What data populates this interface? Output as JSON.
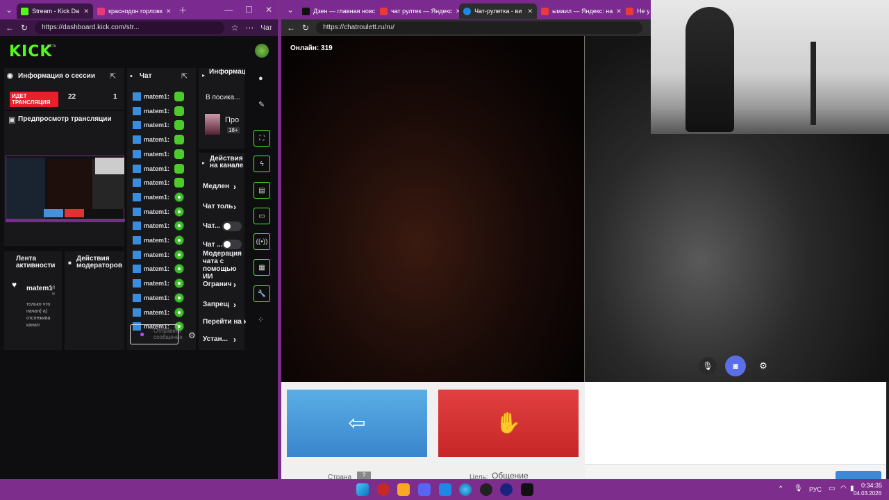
{
  "left_browser": {
    "tabs": [
      {
        "label": "Stream - Kick Da",
        "color": "#53fc18",
        "active": true
      },
      {
        "label": "краснодон горловк",
        "color": "#e83a7a",
        "active": false
      }
    ],
    "url": "https://dashboard.kick.com/str...",
    "copilot_label": "Чат"
  },
  "kick": {
    "logo": "KICK",
    "beta": "BETA",
    "session_panel": {
      "title": "Информация о сессии",
      "status": "ИДЕТ ТРАНСЛЯЦИЯ",
      "viewers": "22",
      "followers": "1"
    },
    "preview_title": "Предпросмотр трансляции",
    "chat": {
      "title": "Чат",
      "rows": [
        {
          "user": "matem1:",
          "emote": "green"
        },
        {
          "user": "matem1:",
          "emote": "green"
        },
        {
          "user": "matem1:",
          "emote": "green"
        },
        {
          "user": "matem1:",
          "emote": "green"
        },
        {
          "user": "matem1:",
          "emote": "green"
        },
        {
          "user": "matem1:",
          "emote": "green"
        },
        {
          "user": "matem1:",
          "emote": "green"
        },
        {
          "user": "matem1:",
          "emote": "round"
        },
        {
          "user": "matem1:",
          "emote": "round"
        },
        {
          "user": "matem1:",
          "emote": "round"
        },
        {
          "user": "matem1:",
          "emote": "round"
        },
        {
          "user": "matem1:",
          "emote": "round"
        },
        {
          "user": "matem1:",
          "emote": "round"
        },
        {
          "user": "matem1:",
          "emote": "round"
        },
        {
          "user": "matem1:",
          "emote": "round"
        },
        {
          "user": "matem1:",
          "emote": "round"
        },
        {
          "user": "matem1:",
          "emote": "round"
        }
      ],
      "input_placeholder": "Отправить сообщение"
    },
    "stream_info": {
      "title": "Информация о трансляции",
      "category_line": "В посика...",
      "category_name": "Про",
      "age_badge": "18+"
    },
    "channel_actions": {
      "title": "Действия на канале",
      "items": [
        "Медлен",
        "Чат толь",
        "Чат...",
        "Чат ...",
        "Модерация чата с помощью ИИ",
        "Огранич",
        "Запрещ",
        "Перейти на к",
        "Устан..."
      ]
    },
    "activity": {
      "title": "Лента активности",
      "user": "matem1",
      "suffix": "Mi",
      "suffix2": "н",
      "text": "только что начал(-а) отслежива канал"
    },
    "mod_actions": {
      "title": "Действия модераторов"
    }
  },
  "right_browser": {
    "tabs": [
      {
        "label": "Дзен — главная новс",
        "color": "#111111",
        "active": false
      },
      {
        "label": "чат рултек — Яндекс",
        "color": "#e83a3a",
        "active": false
      },
      {
        "label": "Чат-рулетка - ви",
        "color": "#1e88e5",
        "active": true
      },
      {
        "label": "ымаил — Яндекс: на",
        "color": "#e83a3a",
        "active": false
      },
      {
        "label": "Не у",
        "color": "#e83a3a",
        "active": false
      }
    ],
    "url": "https://chatroulett.ru/ru/",
    "online_label": "Онлайн: 319",
    "country_label": "Страна",
    "country_value": "?",
    "goal_label": "Цель:",
    "goal_value": "Общение"
  },
  "taskbar": {
    "lang": "РУС",
    "time": "0:34:35",
    "date": "04.03.2026"
  }
}
